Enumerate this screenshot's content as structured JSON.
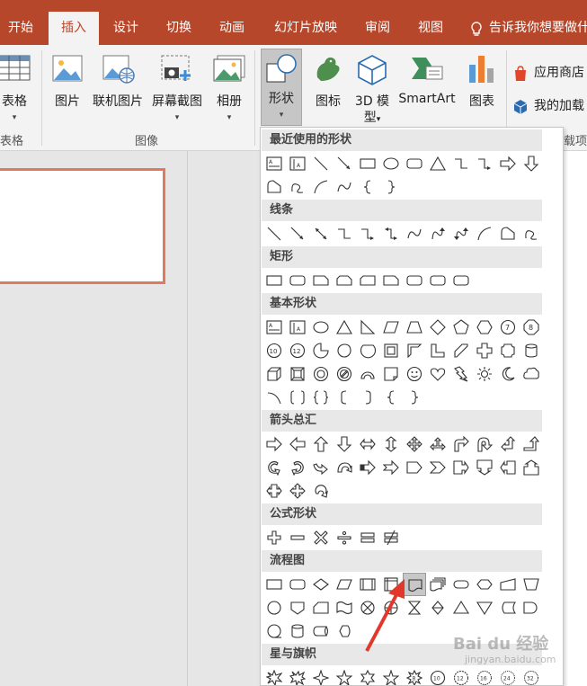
{
  "ribbon_tabs": [
    "开始",
    "插入",
    "设计",
    "切换",
    "动画",
    "幻灯片放映",
    "审阅",
    "视图"
  ],
  "active_tab": "插入",
  "tell_me": "告诉我你想要做什么",
  "colors": {
    "accent": "#b7472a",
    "ribbon_bg": "#f3f3f3",
    "selected": "#c6c6c6",
    "arrow": "#e1382b"
  },
  "ribbon": {
    "table_label": "表格",
    "table_group": "表格",
    "picture_label": "图片",
    "online_picture_label": "联机图片",
    "screenshot_label": "屏幕截图",
    "album_label": "相册",
    "images_group": "图像",
    "shapes_label": "形状",
    "icons_label": "图标",
    "model3d_label_line1": "3D 模",
    "model3d_label_line2": "型",
    "smartart_label": "SmartArt",
    "chart_label": "图表",
    "addins_group_partial": "载项",
    "store_label": "应用商店",
    "myaddins_label": "我的加载"
  },
  "gallery": {
    "categories": [
      {
        "title": "最近使用的形状"
      },
      {
        "title": "线条"
      },
      {
        "title": "矩形"
      },
      {
        "title": "基本形状"
      },
      {
        "title": "箭头总汇"
      },
      {
        "title": "公式形状"
      },
      {
        "title": "流程图"
      },
      {
        "title": "星与旗帜"
      }
    ],
    "selected_shape": "流程图: 文档"
  },
  "watermark": {
    "brand": "Bai du 经验",
    "url": "jingyan.baidu.com"
  }
}
